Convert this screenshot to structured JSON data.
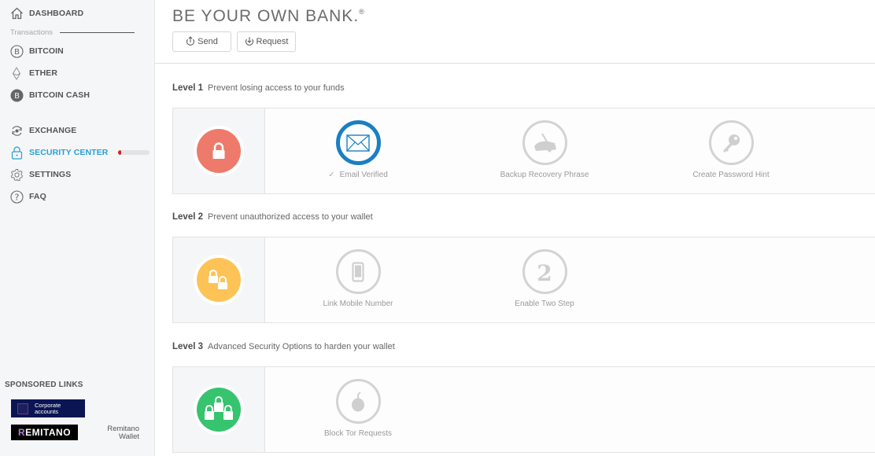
{
  "sidebar": {
    "dashboard": {
      "label": "DASHBOARD",
      "icon": "home-icon"
    },
    "transactions_label": "Transactions",
    "wallets": [
      {
        "label": "BITCOIN",
        "icon": "bitcoin-icon"
      },
      {
        "label": "ETHER",
        "icon": "ether-icon"
      },
      {
        "label": "BITCOIN CASH",
        "icon": "bitcoin-cash-icon"
      }
    ],
    "exchange": {
      "label": "EXCHANGE",
      "icon": "exchange-icon"
    },
    "security_center": {
      "label": "SECURITY CENTER",
      "icon": "lock-icon",
      "progress": 0.1,
      "progress_color": "#d0242c",
      "active": true
    },
    "settings": {
      "label": "SETTINGS",
      "icon": "gear-icon"
    },
    "faq": {
      "label": "FAQ",
      "icon": "question-icon"
    },
    "sponsored_label": "SPONSORED LINKS",
    "ads": {
      "corporate": "Corporate accounts",
      "corporate_line1": "Corporate",
      "corporate_line2": "accounts",
      "remitano_logo_r": "R",
      "remitano_logo_rest": "EMITANO",
      "remitano_wallet_line1": "Remitano",
      "remitano_wallet_line2": "Wallet"
    }
  },
  "header": {
    "title": "BE YOUR OWN BANK.",
    "registered_mark": "®",
    "send_label": "Send",
    "request_label": "Request"
  },
  "levels": [
    {
      "name": "Level 1",
      "description": "Prevent losing access to your funds",
      "color": "#ee7a6b",
      "steps": [
        {
          "label": "Email Verified",
          "completed": true,
          "check": "✓",
          "icon": "envelope-icon"
        },
        {
          "label": "Backup Recovery Phrase",
          "completed": false,
          "icon": "backup-phrase-icon"
        },
        {
          "label": "Create Password Hint",
          "completed": false,
          "icon": "key-icon"
        }
      ]
    },
    {
      "name": "Level 2",
      "description": "Prevent unauthorized access to your wallet",
      "color": "#fdc356",
      "steps": [
        {
          "label": "Link Mobile Number",
          "completed": false,
          "icon": "mobile-phone-icon"
        },
        {
          "label": "Enable Two Step",
          "completed": false,
          "icon": "two-step-icon"
        }
      ]
    },
    {
      "name": "Level 3",
      "description": "Advanced Security Options to harden your wallet",
      "color": "#36c46e",
      "steps": [
        {
          "label": "Block Tor Requests",
          "completed": false,
          "icon": "tor-onion-icon"
        }
      ]
    }
  ]
}
